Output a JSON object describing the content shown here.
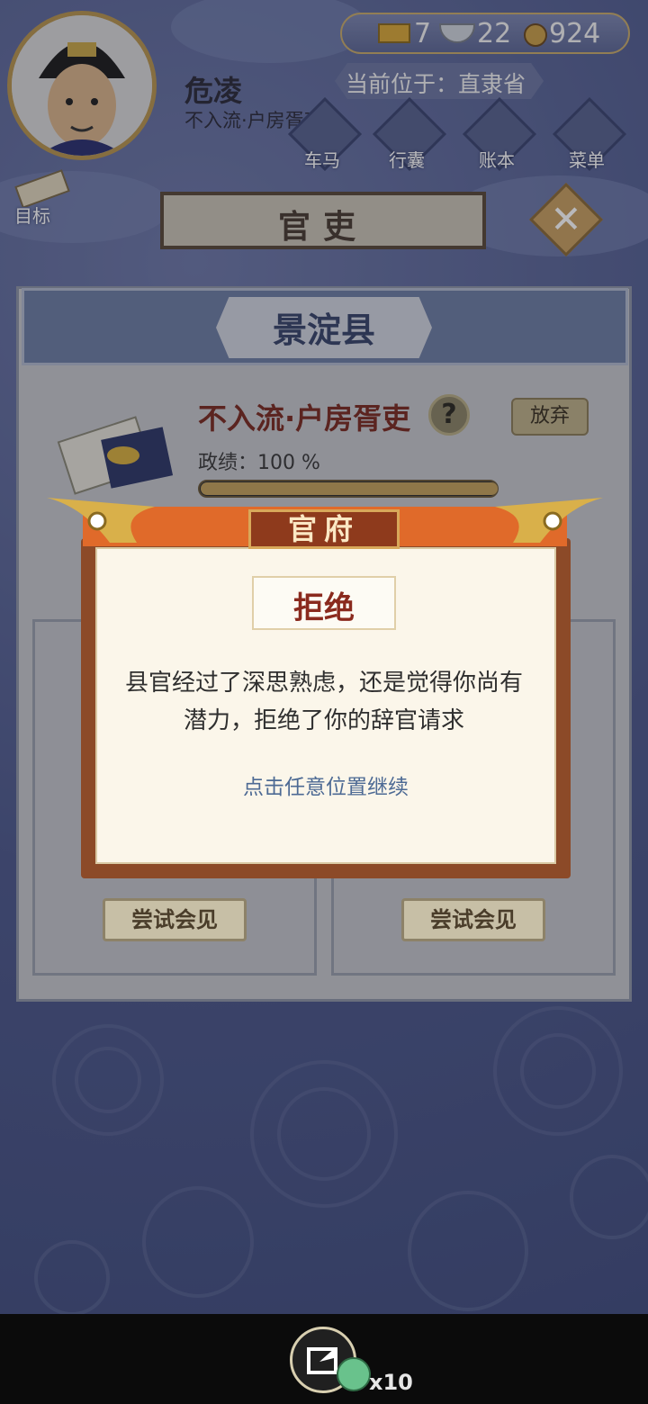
{
  "player": {
    "name": "危凌",
    "rank_short": "不入流·户房胥吏"
  },
  "currency": {
    "gold": "7",
    "silver": "22",
    "copper": "924"
  },
  "location": "当前位于：直隶省",
  "top_buttons": [
    "车马",
    "行囊",
    "账本",
    "菜单"
  ],
  "target_label": "目标",
  "header_title": "官吏",
  "county": "景淀县",
  "office": {
    "title": "不入流·户房胥吏",
    "abandon_label": "放弃",
    "help_label": "?",
    "performance_label": "政绩：100 %",
    "performance_fraction": 1.0
  },
  "slots": {
    "meet_label_left": "尝试会见",
    "meet_label_right": "尝试会见"
  },
  "modal": {
    "banner": "官府",
    "title": "拒绝",
    "message": "县官经过了深思熟虑，还是觉得你尚有潜力，拒绝了你的辞官请求",
    "continue_hint": "点击任意位置继续"
  },
  "bottom": {
    "share_count": "x10"
  },
  "colors": {
    "accent_red": "#8a2a1e",
    "gold": "#c4a35c",
    "bg_blue": "#4e5a8c"
  }
}
